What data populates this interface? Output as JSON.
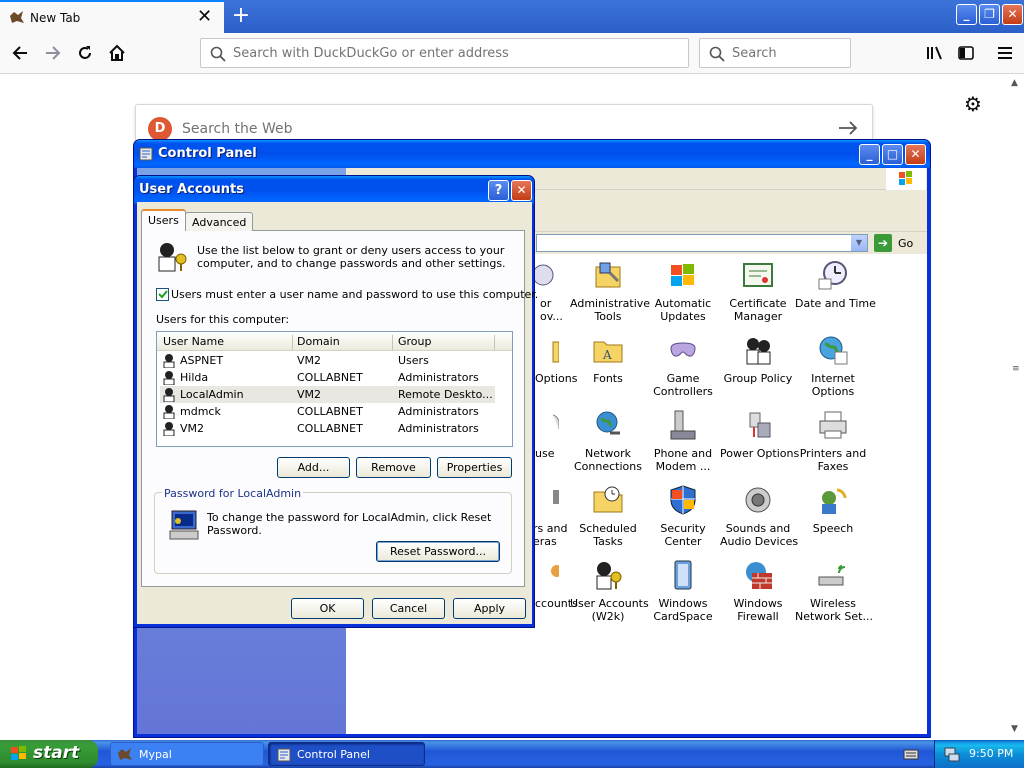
{
  "browser": {
    "tab_title": "New Tab",
    "urlbar_placeholder": "Search with DuckDuckGo or enter address",
    "search_placeholder": "Search",
    "newtab_search_placeholder": "Search the Web"
  },
  "control_panel": {
    "title": "Control Panel",
    "go_label": "Go",
    "items": [
      {
        "label": "or\nov...",
        "icon": "partial-icon"
      },
      {
        "label": "Administrative\nTools",
        "icon": "administrative-tools-icon"
      },
      {
        "label": "Automatic\nUpdates",
        "icon": "windows-update-icon"
      },
      {
        "label": "Certificate\nManager",
        "icon": "certificate-icon"
      },
      {
        "label": "Date and Time",
        "icon": "clock-icon"
      },
      {
        "label": "Options",
        "icon": "folder-options-icon"
      },
      {
        "label": "Fonts",
        "icon": "fonts-folder-icon"
      },
      {
        "label": "Game\nControllers",
        "icon": "gamepad-icon"
      },
      {
        "label": "Group Policy",
        "icon": "group-policy-icon"
      },
      {
        "label": "Internet\nOptions",
        "icon": "globe-icon"
      },
      {
        "label": "use",
        "icon": "mouse-icon"
      },
      {
        "label": "Network\nConnections",
        "icon": "network-icon"
      },
      {
        "label": "Phone and\nModem ...",
        "icon": "phone-modem-icon"
      },
      {
        "label": "Power Options",
        "icon": "power-icon"
      },
      {
        "label": "Printers and\nFaxes",
        "icon": "printer-icon"
      },
      {
        "label": "rs and\neras",
        "icon": "camera-icon"
      },
      {
        "label": "Scheduled\nTasks",
        "icon": "scheduled-tasks-icon"
      },
      {
        "label": "Security\nCenter",
        "icon": "shield-icon"
      },
      {
        "label": "Sounds and\nAudio Devices",
        "icon": "speaker-icon"
      },
      {
        "label": "Speech",
        "icon": "speech-icon"
      },
      {
        "label": "ccounts",
        "icon": "user-accounts-icon"
      },
      {
        "label": "User Accounts\n(W2k)",
        "icon": "user-accounts-w2k-icon"
      },
      {
        "label": "Windows\nCardSpace",
        "icon": "cardspace-icon"
      },
      {
        "label": "Windows\nFirewall",
        "icon": "firewall-icon"
      },
      {
        "label": "Wireless\nNetwork Set...",
        "icon": "wireless-icon"
      }
    ]
  },
  "dialog": {
    "title": "User Accounts",
    "tabs": [
      "Users",
      "Advanced"
    ],
    "intro": "Use the list below to grant or deny users access to your\ncomputer, and to change passwords and other settings.",
    "checkbox_label": "Users must enter a user name and password to use this computer.",
    "checkbox_checked": true,
    "users_label": "Users for this computer:",
    "columns": [
      "User Name",
      "Domain",
      "Group"
    ],
    "users": [
      {
        "name": "ASPNET",
        "domain": "VM2",
        "group": "Users"
      },
      {
        "name": "Hilda",
        "domain": "COLLABNET",
        "group": "Administrators"
      },
      {
        "name": "LocalAdmin",
        "domain": "VM2",
        "group": "Remote Deskto..."
      },
      {
        "name": "mdmck",
        "domain": "COLLABNET",
        "group": "Administrators"
      },
      {
        "name": "VM2",
        "domain": "COLLABNET",
        "group": "Administrators"
      }
    ],
    "selected_user": "LocalAdmin",
    "add_label": "Add...",
    "remove_label": "Remove",
    "properties_label": "Properties",
    "password_group_label": "Password for LocalAdmin",
    "password_text": "To change the password for LocalAdmin, click Reset\nPassword.",
    "reset_label": "Reset Password...",
    "ok_label": "OK",
    "cancel_label": "Cancel",
    "apply_label": "Apply"
  },
  "taskbar": {
    "start_label": "start",
    "items": [
      "Mypal",
      "Control Panel"
    ],
    "clock": "9:50 PM"
  },
  "colors": {
    "xp_title_blue": "#0053ee",
    "firefox_blue": "#0a84ff",
    "taskbar_blue": "#2157d7",
    "start_green": "#379d37"
  }
}
